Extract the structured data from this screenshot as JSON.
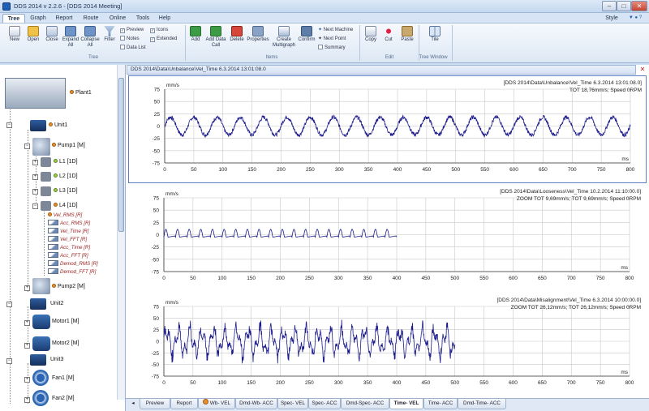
{
  "window": {
    "title": "DDS 2014 v 2.2.6 - [DDS 2014 Meeting]"
  },
  "menu": [
    "Tree",
    "Graph",
    "Report",
    "Route",
    "Online",
    "Tools",
    "Help"
  ],
  "style_menu": "Style",
  "ribbon": {
    "groups": [
      {
        "label": "Tree",
        "buttons": [
          "New",
          "Open",
          "Close",
          "Expand All",
          "Collapse All",
          "Filter"
        ],
        "checks": [
          {
            "label": "Preview",
            "checked": true
          },
          {
            "label": "Icons",
            "checked": true
          },
          {
            "label": "Notes",
            "checked": false
          },
          {
            "label": "Extended",
            "checked": true
          },
          {
            "label": "Data List",
            "checked": false
          }
        ]
      },
      {
        "label": "Items",
        "buttons": [
          "Add",
          "Add Data Call",
          "Delete",
          "Properties",
          "Create Multigraph",
          "Confirm"
        ],
        "small": [
          "Next Machine",
          "Next Point",
          "Summary"
        ]
      },
      {
        "label": "Edit",
        "buttons": [
          "Copy",
          "Cut",
          "Paste"
        ]
      },
      {
        "label": "Tree Window",
        "buttons": [
          "Tile"
        ]
      }
    ]
  },
  "tree": {
    "plant": "Plant1",
    "unit1": "Unit1",
    "pump1": "Pump1 [M]",
    "points": [
      "L1 [1D]",
      "L2 [1D]",
      "L3 [1D]",
      "L4 [1D]"
    ],
    "leaves": [
      "Vel_RMS [R]",
      "Acc_RMS [R]",
      "Vel_Time [R]",
      "Vel_FFT [R]",
      "Acc_Time [R]",
      "Acc_FFT [R]",
      "Demod_RMS [R]",
      "Demod_FFT [R]"
    ],
    "pump2": "Pump2 [M]",
    "unit2": "Unit2",
    "motor1": "Motor1 [M]",
    "motor2": "Motor2 [M]",
    "unit3": "Unit3",
    "fan1": "Fan1 [M]",
    "fan2": "Fan2 [M]"
  },
  "doc_tab": "DDS 2014\\Data\\Unbalance\\Vel_Time   6.3.2014 13:01:08.0",
  "charts": [
    {
      "unit": "mm/s",
      "xunit": "ms",
      "header1": "[DDS 2014\\Data\\Unbalance\\Vel_Time   6.3.2014 13:01:08.0]",
      "header2": "TOT 18,76mm/s; Speed 0RPM"
    },
    {
      "unit": "mm/s",
      "xunit": "ms",
      "header1": "[DDS 2014\\Data\\Looseness\\Vel_Time   10.2.2014 11:10:00.0]",
      "header2": "ZOOM TOT 9,69mm/s; TOT 9,69mm/s; Speed 0RPM"
    },
    {
      "unit": "mm/s",
      "xunit": "ms",
      "header1": "[DDS 2014\\Data\\Misalignment\\Vel_Time   6.3.2014 10:00:00.0]",
      "header2": "ZOOM TOT 26,12mm/s; TOT 26,12mm/s; Speed 0RPM"
    }
  ],
  "chart_data": [
    {
      "type": "line",
      "ylabel": "mm/s",
      "xlabel": "ms",
      "xlim": [
        0,
        800
      ],
      "ylim": [
        -75,
        75
      ],
      "yticks": [
        75,
        50,
        25,
        0,
        -25,
        -50,
        -75
      ],
      "xticks": [
        0,
        50,
        100,
        150,
        200,
        250,
        300,
        350,
        400,
        450,
        500,
        550,
        600,
        650,
        700,
        750,
        800
      ],
      "series": [
        {
          "x_range": [
            0,
            800
          ],
          "amplitude": 18,
          "period_ms": 40
        }
      ]
    },
    {
      "type": "line",
      "ylabel": "mm/s",
      "xlabel": "ms",
      "xlim": [
        0,
        800
      ],
      "ylim": [
        -75,
        75
      ],
      "yticks": [
        75,
        50,
        25,
        0,
        -25,
        -50,
        -75
      ],
      "xticks": [
        0,
        50,
        100,
        150,
        200,
        250,
        300,
        350,
        400,
        450,
        500,
        550,
        600,
        650,
        700,
        750,
        800
      ],
      "series": [
        {
          "x_range": [
            0,
            400
          ],
          "amplitude": 10,
          "period_ms": 20
        }
      ]
    },
    {
      "type": "line",
      "ylabel": "mm/s",
      "xlabel": "ms",
      "xlim": [
        0,
        800
      ],
      "ylim": [
        -75,
        75
      ],
      "yticks": [
        75,
        50,
        25,
        0,
        -25,
        -50,
        -75
      ],
      "xticks": [
        0,
        50,
        100,
        150,
        200,
        250,
        300,
        350,
        400,
        450,
        500,
        550,
        600,
        650,
        700,
        750,
        800
      ],
      "series": [
        {
          "x_range": [
            0,
            500
          ],
          "amplitude": 40,
          "period_ms": 20
        }
      ]
    }
  ],
  "bottom_tabs": [
    "Preview",
    "Report",
    "Wb- VEL",
    "Dmd-Wb- ACC",
    "Spec- VEL",
    "Spec- ACC",
    "Dmd-Spec- ACC",
    "Time- VEL",
    "Time- ACC",
    "Dmd-Time- ACC"
  ],
  "active_tab": "Time- VEL",
  "colors": {
    "line": "#1c1c8c",
    "grid": "#c8c8c8",
    "accent": "#1f5fb5"
  }
}
